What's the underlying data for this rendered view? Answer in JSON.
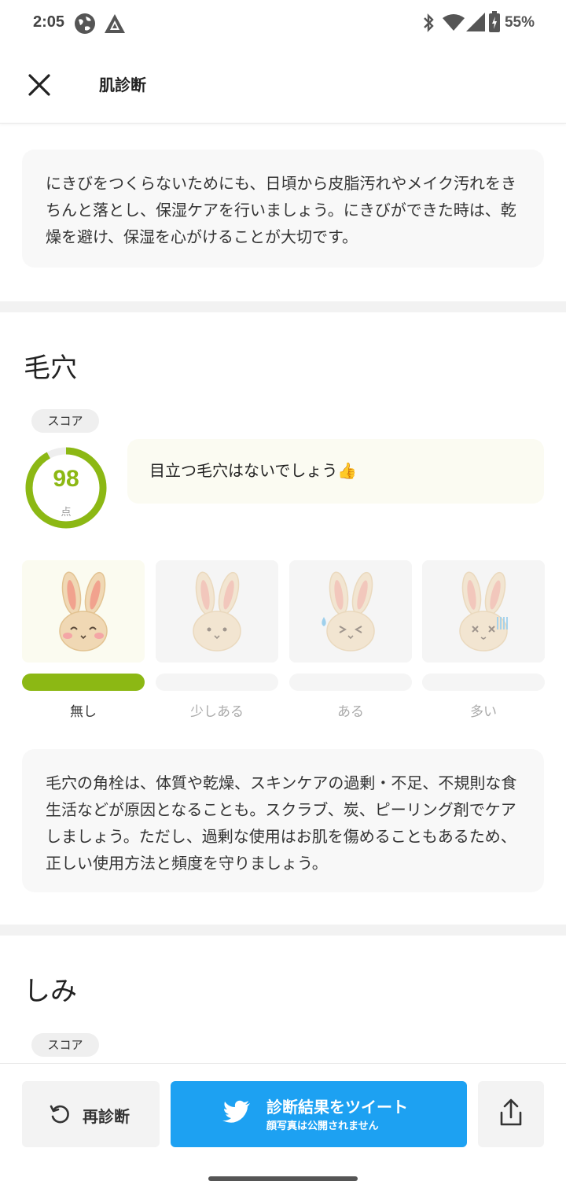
{
  "status_bar": {
    "time": "2:05",
    "battery": "55%"
  },
  "app_bar": {
    "title": "肌診断"
  },
  "acne_advice": "にきびをつくらないためにも、日頃から皮脂汚れやメイク汚れをきちんと落とし、保湿ケアを行いましょう。にきびができた時は、乾燥を避け、保湿を心がけることが大切です。",
  "pores": {
    "title": "毛穴",
    "score_label": "スコア",
    "score": 98,
    "score_unit": "点",
    "comment": "目立つ毛穴はないでしょう👍",
    "levels": [
      {
        "label": "無し",
        "active": true
      },
      {
        "label": "少しある",
        "active": false
      },
      {
        "label": "ある",
        "active": false
      },
      {
        "label": "多い",
        "active": false
      }
    ],
    "advice": "毛穴の角栓は、体質や乾燥、スキンケアの過剰・不足、不規則な食生活などが原因となることも。スクラブ、炭、ピーリング剤でケアしましょう。ただし、過剰な使用はお肌を傷めることもあるため、正しい使用方法と頻度を守りましょう。"
  },
  "spots": {
    "title": "しみ",
    "score_label": "スコア"
  },
  "bottom_bar": {
    "rediagnose": "再診断",
    "tweet_main": "診断結果をツイート",
    "tweet_sub": "顔写真は公開されません"
  },
  "colors": {
    "accent": "#8cb814",
    "twitter": "#1da1f2"
  },
  "icons": [
    "globe-icon",
    "android-studio-icon",
    "bluetooth-icon",
    "wifi-icon",
    "cell-signal-icon",
    "battery-icon",
    "close-icon",
    "refresh-icon",
    "twitter-bird-icon",
    "share-icon"
  ]
}
